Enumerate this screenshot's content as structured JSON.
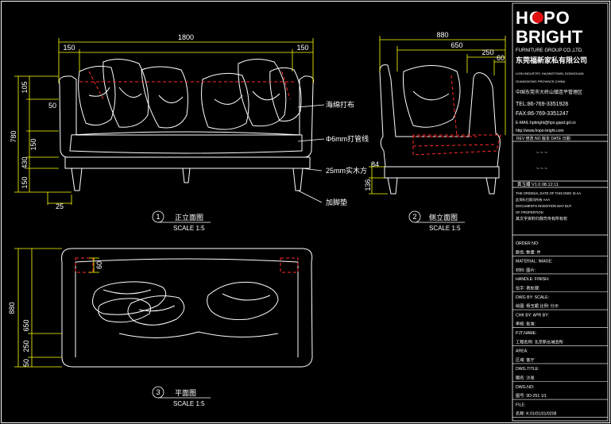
{
  "colors": {
    "background": "#000000",
    "lines": "#ffffff",
    "dimension": "#ffff00",
    "hidden": "#ff2a2a",
    "brand_accent": "#e01010"
  },
  "brand": {
    "logo_line1": "HOPO",
    "logo_line2": "BRIGHT",
    "group": "FURNITURE GROUP CO.,LTD.",
    "company_cn": "东莞福新家私有限公司",
    "addr_en_1": "LIZIN INDUSTRY, HAJINGTOWN, DONGGUAN",
    "addr_en_2": "GUANGDONG PROVINCE,CHINA",
    "addr_cn": "中国东莞市大岭山镇连平管理区",
    "tel": "TEL:86-769-3351928",
    "fax": "FAX:86-769-3351247",
    "email": "E-MAIL:hpbright@hpo.gqod.gd.cn",
    "web": "http://www.hopo-bright.com"
  },
  "revision": {
    "headers": "REV 修改  NO 版本  DATE 日期",
    "row1": "~   ~   ~",
    "row2": "~   ~   ~",
    "row3": "黄玉媚   V1.0   08.12.11"
  },
  "notice": [
    "THE ORIGINAL DATE OF THIS DWG IS AA",
    "此资料归我司所有 AAA",
    "DOCUMENTS INVENTION MAY BUT",
    "OF PROPERTION",
    "其文字资料归我司专有所有权"
  ],
  "title_block": {
    "rows": [
      "ORDER NO:",
      "颜色:                         数量:         件",
      "MATERIAL:                       IMAGE:",
      "材料:                           图片:",
      "HANDLE:                         FINISH:",
      "拉手:                           表处理:",
      "DWG BY:                         SCALE:",
      "绘图:   杨玉媚    比例:    分示",
      "CHK BY:                         APR BY:",
      "审核:                           批准:",
      "PJT.NAME:",
      "工程名称:     北京新长城会所",
      "AREA:",
      "区域:              客厅",
      "DWG.TITLE:",
      "图名:              沙发",
      "DWG.NO:",
      "图号:         3D-251      1/1",
      "FILE:",
      "名称:         K:01/01/01/0208"
    ]
  },
  "views": {
    "front": {
      "number": "1",
      "title": "正立面图",
      "scale": "SCALE 1:5"
    },
    "side": {
      "number": "2",
      "title": "侧立面图",
      "scale": "SCALE 1:5"
    },
    "plan": {
      "number": "3",
      "title": "平面图",
      "scale": "SCALE 1:5"
    }
  },
  "dimensions": {
    "front_width": "1800",
    "front_arm_left": "150",
    "front_arm_right": "150",
    "front_h_total": "780",
    "front_h_back": "105",
    "front_h_arm": "50",
    "front_h_seat": "150",
    "front_h_base": "430",
    "front_h_leg": "150",
    "front_leg_offset": "25",
    "side_depth": "880",
    "side_seat_depth": "650",
    "side_back": "250",
    "side_back2": "60",
    "side_h_base": "84",
    "side_h_leg": "136",
    "plan_depth": "880",
    "plan_seat": "650",
    "plan_front": "250",
    "plan_leg": "50",
    "plan_corner": "60"
  },
  "callouts": {
    "fabric": "海绵打布",
    "pipe": "Φ6mm打管线",
    "wood": "25mm实木方",
    "feet": "加脚垫"
  }
}
